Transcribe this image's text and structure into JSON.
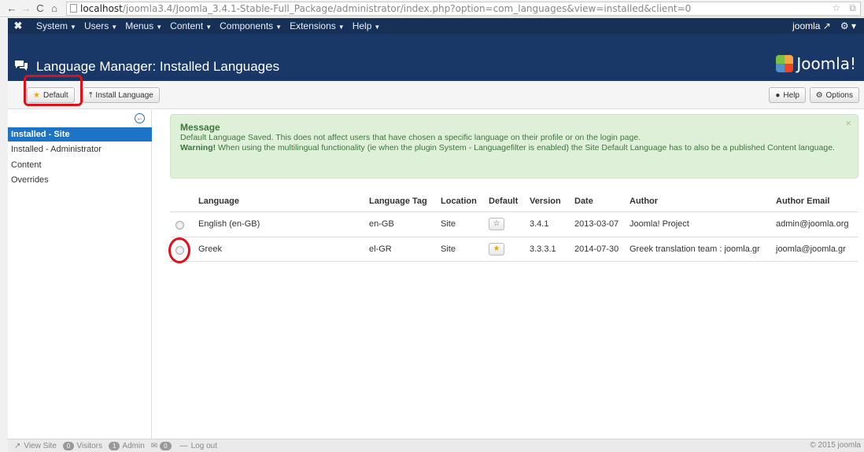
{
  "browser": {
    "back": "←",
    "forward": "→",
    "reload": "C",
    "home": "⌂",
    "url_host": "localhost",
    "url_path": "/joomla3.4/Joomla_3.4.1-Stable-Full_Package/administrator/index.php?option=com_languages&view=installed&client=0",
    "right_icons": "☆ ⧉"
  },
  "topnav": {
    "logo": "✖",
    "menus": [
      "System",
      "Users",
      "Menus",
      "Content",
      "Components",
      "Extensions",
      "Help"
    ],
    "user": "joomla ↗",
    "settings": "⚙ ▾"
  },
  "header": {
    "title_icon": "comments-icon",
    "title": "Language Manager: Installed Languages",
    "brand": "Joomla!"
  },
  "toolbar": {
    "default_label": "Default",
    "install_label": "Install Language",
    "help_label": "Help",
    "options_label": "Options"
  },
  "sidebar": {
    "toggle": "←",
    "items": [
      {
        "label": "Installed - Site",
        "active": true
      },
      {
        "label": "Installed - Administrator",
        "active": false
      },
      {
        "label": "Content",
        "active": false
      },
      {
        "label": "Overrides",
        "active": false
      }
    ]
  },
  "message": {
    "title": "Message",
    "line1": "Default Language Saved. This does not affect users that have chosen a specific language on their profile or on the login page.",
    "warning_label": "Warning!",
    "warning_text": " When using the multilingual functionality (ie when the plugin System - Languagefilter is enabled) the Site Default Language has to also be a published Content language.",
    "close": "×"
  },
  "table": {
    "headers": {
      "language": "Language",
      "tag": "Language Tag",
      "location": "Location",
      "default": "Default",
      "version": "Version",
      "date": "Date",
      "author": "Author",
      "email": "Author Email"
    },
    "rows": [
      {
        "language": "English (en-GB)",
        "tag": "en-GB",
        "location": "Site",
        "default": false,
        "version": "3.4.1",
        "date": "2013-03-07",
        "author": "Joomla! Project",
        "email": "admin@joomla.org"
      },
      {
        "language": "Greek",
        "tag": "el-GR",
        "location": "Site",
        "default": true,
        "version": "3.3.3.1",
        "date": "2014-07-30",
        "author": "Greek translation team : joomla.gr",
        "email": "joomla@joomla.gr"
      }
    ]
  },
  "footer": {
    "view_site": "View Site",
    "visitors_count": "0",
    "visitors": "Visitors",
    "admin_count": "1",
    "admin": "Admin",
    "messages_count": "0",
    "logout": "Log out",
    "copyright": "© 2015 joomla"
  },
  "colors": {
    "nav": "#173058",
    "header": "#1a3867",
    "active": "#1d74c6",
    "success_bg": "#dff0d8",
    "annotation": "#e0101a"
  }
}
